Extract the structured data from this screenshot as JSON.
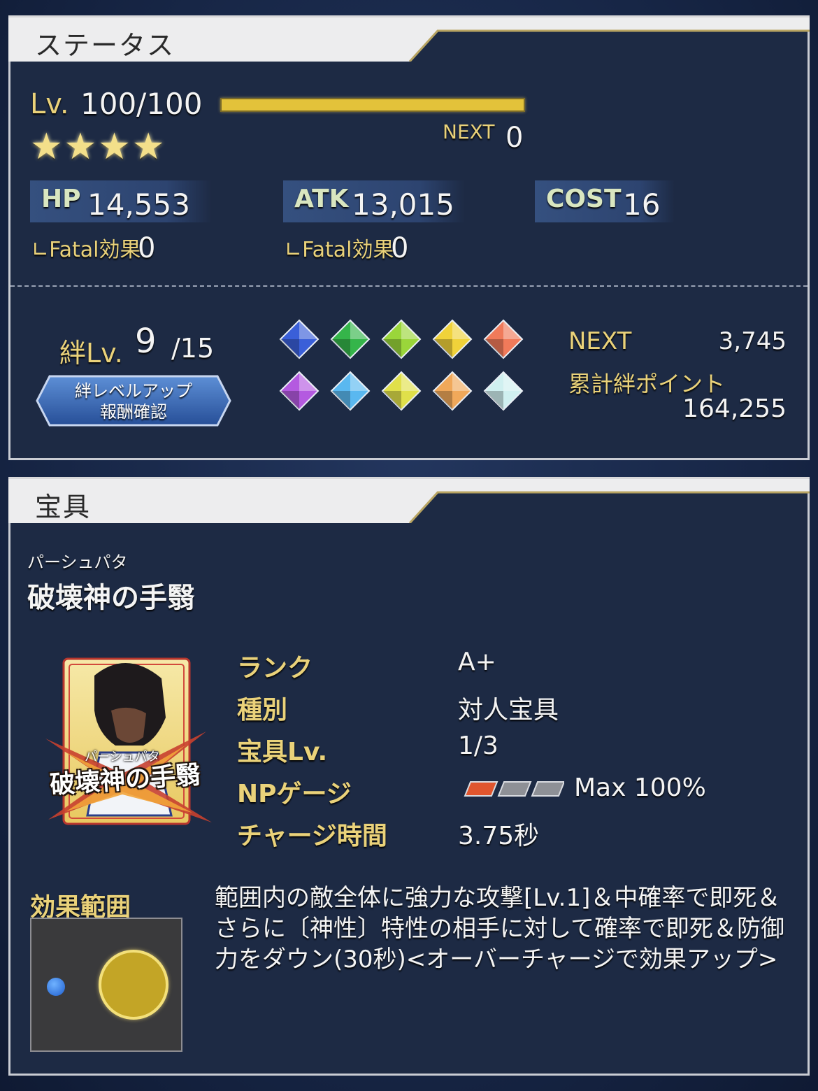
{
  "status": {
    "title": "ステータス",
    "lv_label": "Lv.",
    "lv_value": "100/100",
    "level_progress": 1.0,
    "stars": [
      "★",
      "★",
      "★",
      "★"
    ],
    "next_label": "NEXT",
    "next_value": "0",
    "hp_label": "HP",
    "hp_value": "14,553",
    "atk_label": "ATK",
    "atk_value": "13,015",
    "cost_label": "COST",
    "cost_value": "16",
    "fatal_label": "∟Fatal効果",
    "hp_fatal": "0",
    "atk_fatal": "0",
    "bond_label": "絆Lv.",
    "bond_value": "9",
    "bond_max": "/15",
    "bond_button": "絆レベルアップ\n報酬確認",
    "bond_next_label": "NEXT",
    "bond_next_value": "3,745",
    "bond_total_label": "累計絆ポイント",
    "bond_total_value": "164,255",
    "gem_colors": [
      "#3a5fd8",
      "#35b54a",
      "#9ad63a",
      "#f0d23a",
      "#f07a5a",
      "#b45ae0",
      "#5ab8f0",
      "#e0e04a",
      "#f0a85a",
      "#d0f0f0"
    ]
  },
  "np": {
    "title": "宝具",
    "ruby": "パーシュパタ",
    "name": "破壊神の手翳",
    "rank_label": "ランク",
    "rank_value": "A+",
    "type_label": "種別",
    "type_value": "対人宝具",
    "level_label": "宝具Lv.",
    "level_value": "1/3",
    "gauge_label": "NPゲージ",
    "gauge_value": "Max 100%",
    "gauge_filled": 1,
    "gauge_total": 3,
    "charge_label": "チャージ時間",
    "charge_value": "3.75秒",
    "range_label": "効果範囲",
    "card_title": "破壊神の手翳",
    "card_ruby": "パーシュパタ",
    "description": "範囲内の敵全体に強力な攻撃[Lv.1]＆中確率で即死＆さらに〔神性〕特性の相手に対して確率で即死＆防御力をダウン(30秒)<オーバーチャージで効果アップ>"
  }
}
